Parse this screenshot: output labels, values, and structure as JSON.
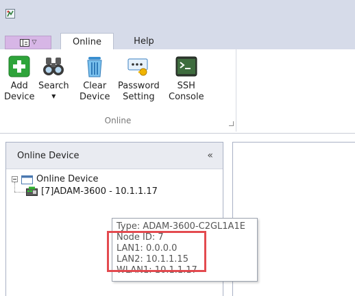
{
  "menu": {
    "tabs": [
      "Online",
      "Help"
    ],
    "active_tab": "Online"
  },
  "ribbon": {
    "buttons": [
      {
        "label": "Add\nDevice",
        "icon": "add-icon"
      },
      {
        "label": "Search",
        "icon": "binoculars-icon",
        "has_dropdown": true
      },
      {
        "label": "Clear\nDevice",
        "icon": "trash-icon"
      },
      {
        "label": "Password\nSetting",
        "icon": "password-icon"
      },
      {
        "label": "SSH\nConsole",
        "icon": "terminal-icon"
      }
    ],
    "group_label": "Online"
  },
  "left_panel": {
    "title": "Online Device",
    "collapse_glyph": "«",
    "tree": {
      "root_label": "Online Device",
      "children": [
        "[7]ADAM-3600 - 10.1.1.17"
      ]
    }
  },
  "tooltip": {
    "lines": [
      "Type: ADAM-3600-C2GL1A1E",
      "Node ID: 7",
      "LAN1: 0.0.0.0",
      "LAN2: 10.1.1.15",
      "WLAN1: 10.1.1.17"
    ]
  },
  "colors": {
    "chrome_background": "#d6dbe9",
    "menu_button": "#d7b6e6",
    "highlight": "#e34a4f",
    "add_green": "#2ea43a"
  }
}
